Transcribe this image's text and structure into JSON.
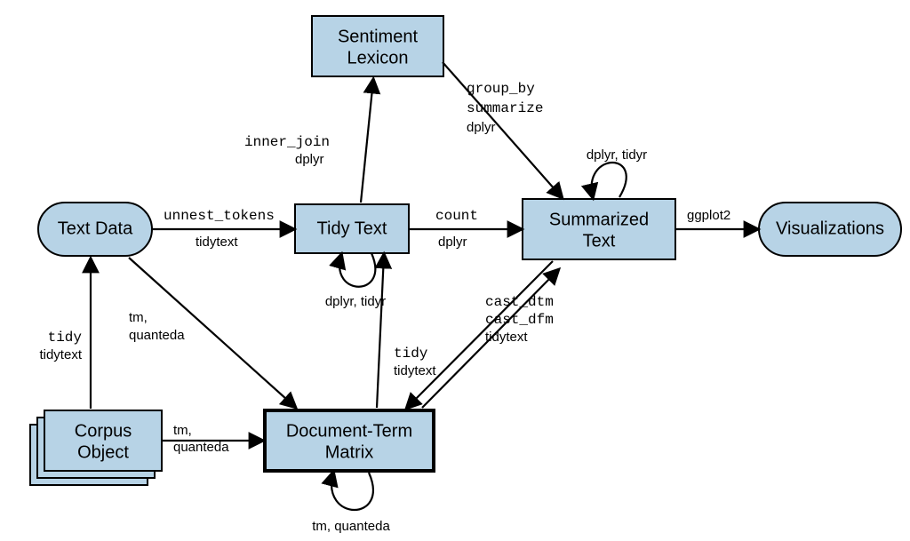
{
  "nodes": {
    "text_data": "Text Data",
    "tidy_text": "Tidy Text",
    "sentiment_lexicon_l1": "Sentiment",
    "sentiment_lexicon_l2": "Lexicon",
    "summarized_text_l1": "Summarized",
    "summarized_text_l2": "Text",
    "visualizations": "Visualizations",
    "corpus_object_l1": "Corpus",
    "corpus_object_l2": "Object",
    "dtm_l1": "Document-Term",
    "dtm_l2": "Matrix"
  },
  "edges": {
    "textdata_tidytext_fn": "unnest_tokens",
    "textdata_tidytext_pkg": "tidytext",
    "tidytext_sentiment_fn": "inner_join",
    "tidytext_sentiment_pkg": "dplyr",
    "tidytext_summarized_fn": "count",
    "tidytext_summarized_pkg": "dplyr",
    "tidytext_self_pkg": "dplyr, tidyr",
    "summarized_self_pkg": "dplyr, tidyr",
    "summarized_viz_pkg": "ggplot2",
    "sentiment_summarized_fn1": "group_by",
    "sentiment_summarized_fn2": "summarize",
    "sentiment_summarized_pkg": "dplyr",
    "corpus_textdata_fn": "tidy",
    "corpus_textdata_pkg": "tidytext",
    "corpus_dtm_fn": "tm,",
    "corpus_dtm_pkg": "quanteda",
    "textdata_dtm_fn": "tm,",
    "textdata_dtm_pkg": "quanteda",
    "dtm_tidytext_fn": "tidy",
    "dtm_tidytext_pkg": "tidytext",
    "summarized_dtm_fn1": "cast_dtm",
    "summarized_dtm_fn2": "cast_dfm",
    "summarized_dtm_pkg": "tidytext",
    "dtm_self_pkg": "tm, quanteda"
  }
}
